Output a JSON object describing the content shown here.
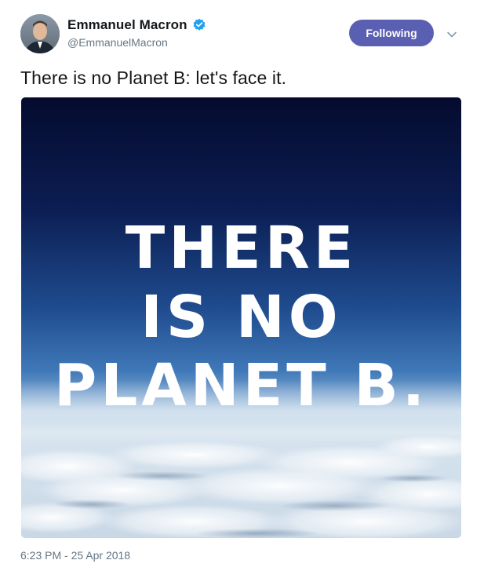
{
  "author": {
    "display_name": "Emmanuel Macron",
    "handle": "@EmmanuelMacron",
    "verified": true,
    "avatar_icon": "profile-photo"
  },
  "actions": {
    "follow_label": "Following",
    "follow_color": "#5a5fb1",
    "more_icon": "chevron-down-icon"
  },
  "tweet": {
    "text": "There is no Planet B: let's face it.",
    "timestamp": "6:23 PM - 25 Apr 2018"
  },
  "media": {
    "lines": [
      "THERE",
      "IS NO",
      "PLANET B."
    ],
    "sky_top_color": "#060d33",
    "sky_mid_color": "#2f64a7",
    "cloud_color": "#e6edf4"
  },
  "colors": {
    "verified_blue": "#1da1f2",
    "secondary_text": "#657786"
  }
}
